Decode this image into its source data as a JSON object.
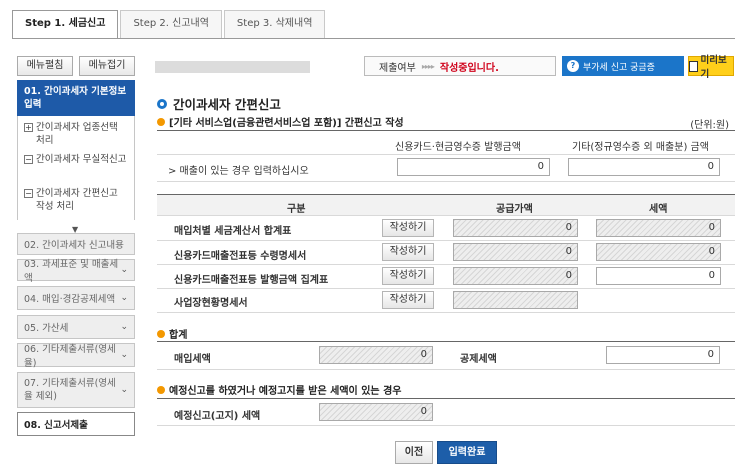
{
  "tabs": [
    {
      "label": "Step 1. 세금신고"
    },
    {
      "label": "Step 2. 신고내역"
    },
    {
      "label": "Step 3. 삭제내역"
    }
  ],
  "sidebar": {
    "expand_label": "메뉴펼침",
    "collapse_label": "메뉴접기",
    "items": [
      {
        "label": "01. 간이과세자 기본정보 입력"
      },
      {
        "label": "02. 간이과세자 신고내용"
      },
      {
        "label": "03. 과세표준 및 매출세액"
      },
      {
        "label": "04. 매입·경감공제세액"
      },
      {
        "label": "05. 가산세"
      },
      {
        "label": "06. 기타제출서류(영세율)"
      },
      {
        "label": "07. 기타제출서류(영세율 제외)"
      },
      {
        "label": "08. 신고서제출"
      }
    ],
    "subitems": [
      {
        "icon": "+",
        "label": "간이과세자 업종선택 처리"
      },
      {
        "icon": "−",
        "label": "간이과세자 무실적신고"
      },
      {
        "icon": "−",
        "label": "간이과세자 간편신고 작성 처리"
      }
    ]
  },
  "status": {
    "label": "제출여부",
    "arrows": "▸▸▸▸",
    "state": "작성중입니다."
  },
  "faq_button": "부가세 신고 궁금증",
  "preview_button": "미리보기",
  "main_title": "간이과세자 간편신고",
  "section1": {
    "title": "[기타 서비스업(금융관련서비스업 포함)] 간편신고 작성",
    "unit": "(단위:원)",
    "col_card": "신용카드·현금영수증 발행금액",
    "col_other": "기타(정규영수증 외 매출분) 금액",
    "row_label": "> 매출이 있는 경우 입력하십시오",
    "card_value": "0",
    "other_value": "0"
  },
  "purchase_table": {
    "header_category": "구분",
    "header_supply": "공급가액",
    "header_tax": "세액",
    "write_label": "작성하기",
    "rows": [
      {
        "label": "매입처별 세금계산서 합계표",
        "supply": "0",
        "tax": "0"
      },
      {
        "label": "신용카드매출전표등 수령명세서",
        "supply": "0",
        "tax": "0"
      },
      {
        "label": "신용카드매출전표등 발행금액 집계표",
        "supply": "0",
        "tax": "0"
      },
      {
        "label": "사업장현황명세서",
        "supply": "",
        "tax": ""
      }
    ]
  },
  "total": {
    "title": "합계",
    "purchase_tax_label": "매입세액",
    "purchase_tax_value": "0",
    "deduction_label": "공제세액",
    "deduction_value": "0"
  },
  "preliminary": {
    "title": "예정신고를 하였거나 예정고지를 받은 세액이 있는 경우",
    "label": "예정신고(고지) 세액",
    "value": "0"
  },
  "buttons": {
    "prev": "이전",
    "done": "입력완료"
  }
}
